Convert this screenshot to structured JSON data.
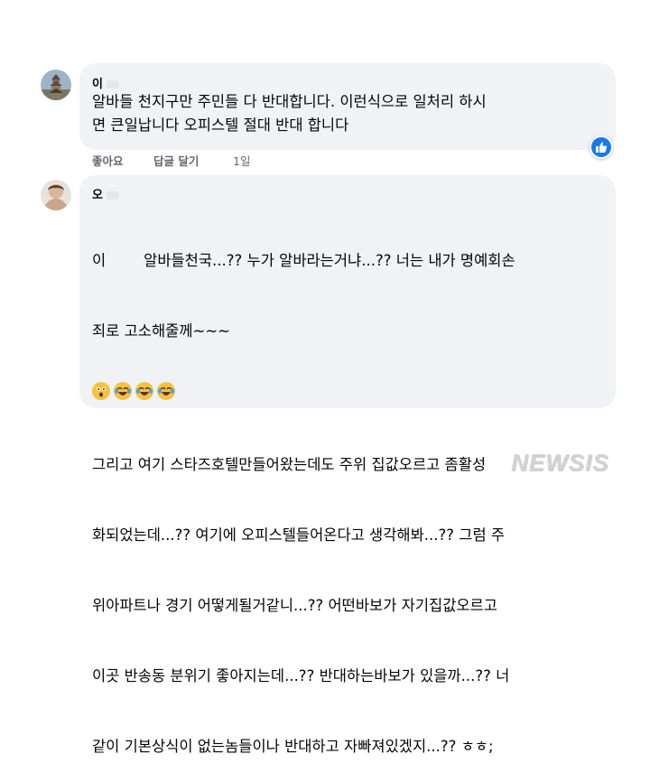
{
  "comments": [
    {
      "author": "이",
      "lines": [
        "알바들 천지구만 주민들 다 반대합니다. 이런식으로 일처리 하시",
        "면 큰일납니다 오피스텔 절대 반대 합니다"
      ],
      "actions": {
        "like": "좋아요",
        "reply": "답글 달기",
        "time": "1일"
      },
      "reaction_icon": "like-thumb-icon"
    },
    {
      "author": "오",
      "lines": [
        "이        알바들천국...?? 누가 알바라는거냐...?? 너는 내가 명예회손",
        "죄로 고소해줄께~~~",
        "",
        "그리고 여기 스타즈호텔만들어왔는데도 주위 집값오르고 좀활성",
        "화되었는데...?? 여기에 오피스텔들어온다고 생각해봐...?? 그럼 주",
        "위아파트나 경기 어떻게될거같니...?? 어떤바보가 자기집값오르고",
        "이곳 반송동 분위기 좋아지는데...?? 반대하는바보가 있을까...?? 너",
        "같이 기본상식이 없는놈들이나 반대하고 자빠져있겠지...?? ㅎㅎ;"
      ],
      "emojis": [
        "astonished-face-icon",
        "joy-face-icon",
        "joy-face-icon",
        "joy-face-icon"
      ]
    }
  ],
  "watermark": "NEWSIS"
}
